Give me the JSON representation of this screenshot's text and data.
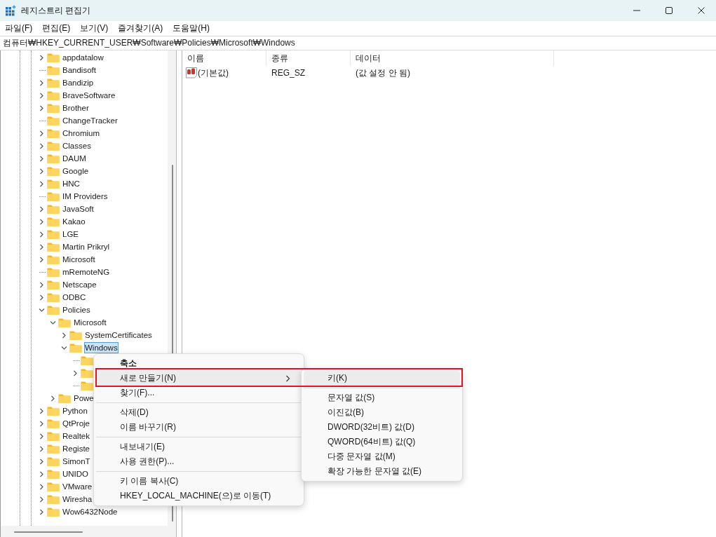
{
  "window": {
    "title": "레지스트리 편집기"
  },
  "menu_bar": [
    {
      "label": "파일(F)"
    },
    {
      "label": "편집(E)"
    },
    {
      "label": "보기(V)"
    },
    {
      "label": "즐겨찾기(A)"
    },
    {
      "label": "도움말(H)"
    }
  ],
  "address": "컴퓨터₩HKEY_CURRENT_USER₩Software₩Policies₩Microsoft₩Windows",
  "tree": [
    {
      "label": "appdatalow",
      "expandable": true,
      "expanded": false,
      "selected": false
    },
    {
      "label": "Bandisoft",
      "expandable": false,
      "expanded": false,
      "selected": false
    },
    {
      "label": "Bandizip",
      "expandable": true,
      "expanded": false,
      "selected": false
    },
    {
      "label": "BraveSoftware",
      "expandable": true,
      "expanded": false,
      "selected": false
    },
    {
      "label": "Brother",
      "expandable": true,
      "expanded": false,
      "selected": false
    },
    {
      "label": "ChangeTracker",
      "expandable": false,
      "expanded": false,
      "selected": false
    },
    {
      "label": "Chromium",
      "expandable": true,
      "expanded": false,
      "selected": false
    },
    {
      "label": "Classes",
      "expandable": true,
      "expanded": false,
      "selected": false
    },
    {
      "label": "DAUM",
      "expandable": true,
      "expanded": false,
      "selected": false
    },
    {
      "label": "Google",
      "expandable": true,
      "expanded": false,
      "selected": false
    },
    {
      "label": "HNC",
      "expandable": true,
      "expanded": false,
      "selected": false
    },
    {
      "label": "IM Providers",
      "expandable": false,
      "expanded": false,
      "selected": false
    },
    {
      "label": "JavaSoft",
      "expandable": true,
      "expanded": false,
      "selected": false
    },
    {
      "label": "Kakao",
      "expandable": true,
      "expanded": false,
      "selected": false
    },
    {
      "label": "LGE",
      "expandable": true,
      "expanded": false,
      "selected": false
    },
    {
      "label": "Martin Prikryl",
      "expandable": true,
      "expanded": false,
      "selected": false
    },
    {
      "label": "Microsoft",
      "expandable": true,
      "expanded": false,
      "selected": false
    },
    {
      "label": "mRemoteNG",
      "expandable": false,
      "expanded": false,
      "selected": false
    },
    {
      "label": "Netscape",
      "expandable": true,
      "expanded": false,
      "selected": false
    },
    {
      "label": "ODBC",
      "expandable": true,
      "expanded": false,
      "selected": false
    },
    {
      "label": "Policies",
      "expandable": true,
      "expanded": true,
      "selected": false,
      "children": [
        {
          "label": "Microsoft",
          "expandable": true,
          "expanded": true,
          "selected": false,
          "children": [
            {
              "label": "SystemCertificates",
              "expandable": true,
              "expanded": false,
              "selected": false
            },
            {
              "label": "Windows",
              "expandable": true,
              "expanded": true,
              "selected": true,
              "children": [
                {
                  "expandable": false,
                  "expanded": false,
                  "selected": false
                },
                {
                  "expandable": true,
                  "expanded": false,
                  "selected": false
                },
                {
                  "expandable": false,
                  "expanded": false,
                  "selected": false
                }
              ]
            }
          ]
        },
        {
          "label": "Powe",
          "expandable": true,
          "expanded": false,
          "selected": false
        }
      ]
    },
    {
      "label": "Python",
      "expandable": true,
      "expanded": false,
      "selected": false
    },
    {
      "label": "QtProje",
      "expandable": true,
      "expanded": false,
      "selected": false
    },
    {
      "label": "Realtek",
      "expandable": true,
      "expanded": false,
      "selected": false
    },
    {
      "label": "Registe",
      "expandable": true,
      "expanded": false,
      "selected": false
    },
    {
      "label": "SimonT",
      "expandable": true,
      "expanded": false,
      "selected": false
    },
    {
      "label": "UNIDO",
      "expandable": true,
      "expanded": false,
      "selected": false
    },
    {
      "label": "VMware",
      "expandable": true,
      "expanded": false,
      "selected": false
    },
    {
      "label": "Wiresha",
      "expandable": true,
      "expanded": false,
      "selected": false
    },
    {
      "label": "Wow6432Node",
      "expandable": true,
      "expanded": false,
      "selected": false
    }
  ],
  "values": {
    "columns": [
      "이름",
      "종류",
      "데이터"
    ],
    "rows": [
      {
        "kind": "string",
        "name": "(기본값)",
        "type": "REG_SZ",
        "data": "(값 설정 안 됨)"
      }
    ]
  },
  "context_menu": [
    {
      "kind": "item",
      "label": "축소",
      "default": true,
      "hovered": false
    },
    {
      "kind": "submenu",
      "label": "새로 만들기(N)",
      "default": false,
      "hovered": true,
      "highlighted": true
    },
    {
      "kind": "item",
      "label": "찾기(F)...",
      "default": false,
      "hovered": false
    },
    {
      "kind": "separator"
    },
    {
      "kind": "item",
      "label": "삭제(D)",
      "default": false,
      "hovered": false
    },
    {
      "kind": "item",
      "label": "이름 바꾸기(R)",
      "default": false,
      "hovered": false
    },
    {
      "kind": "separator"
    },
    {
      "kind": "item",
      "label": "내보내기(E)",
      "default": false,
      "hovered": false
    },
    {
      "kind": "item",
      "label": "사용 권한(P)...",
      "default": false,
      "hovered": false
    },
    {
      "kind": "separator"
    },
    {
      "kind": "item",
      "label": "키 이름 복사(C)",
      "default": false,
      "hovered": false
    },
    {
      "kind": "item",
      "label": "HKEY_LOCAL_MACHINE(으)로 이동(T)",
      "default": false,
      "hovered": false
    }
  ],
  "submenu": [
    {
      "kind": "item",
      "label": "키(K)",
      "hovered": true
    },
    {
      "kind": "separator"
    },
    {
      "kind": "item",
      "label": "문자열 값(S)",
      "hovered": false
    },
    {
      "kind": "item",
      "label": "이진값(B)",
      "hovered": false
    },
    {
      "kind": "item",
      "label": "DWORD(32비트) 값(D)",
      "hovered": false
    },
    {
      "kind": "item",
      "label": "QWORD(64비트) 값(Q)",
      "hovered": false
    },
    {
      "kind": "item",
      "label": "다중 문자열 값(M)",
      "hovered": false
    },
    {
      "kind": "item",
      "label": "확장 가능한 문자열 값(E)",
      "hovered": false
    }
  ],
  "highlight_frame": {
    "color": "#e81123"
  }
}
